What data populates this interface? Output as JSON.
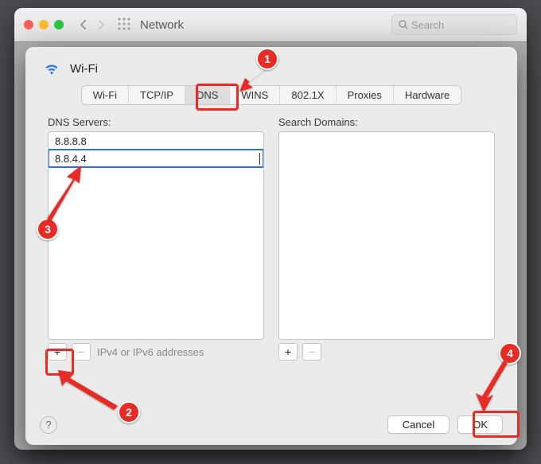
{
  "window": {
    "title": "Network",
    "search_placeholder": "Search"
  },
  "sheet": {
    "title": "Wi-Fi",
    "tabs": [
      "Wi-Fi",
      "TCP/IP",
      "DNS",
      "WINS",
      "802.1X",
      "Proxies",
      "Hardware"
    ],
    "active_tab": "DNS",
    "dns": {
      "heading": "DNS Servers:",
      "servers": [
        "8.8.8.8",
        "8.8.4.4"
      ],
      "editing_index": 1,
      "hint": "IPv4 or IPv6 addresses"
    },
    "domains": {
      "heading": "Search Domains:",
      "items": []
    },
    "buttons": {
      "cancel": "Cancel",
      "ok": "OK"
    },
    "help": "?"
  },
  "annotations": [
    "1",
    "2",
    "3",
    "4"
  ]
}
